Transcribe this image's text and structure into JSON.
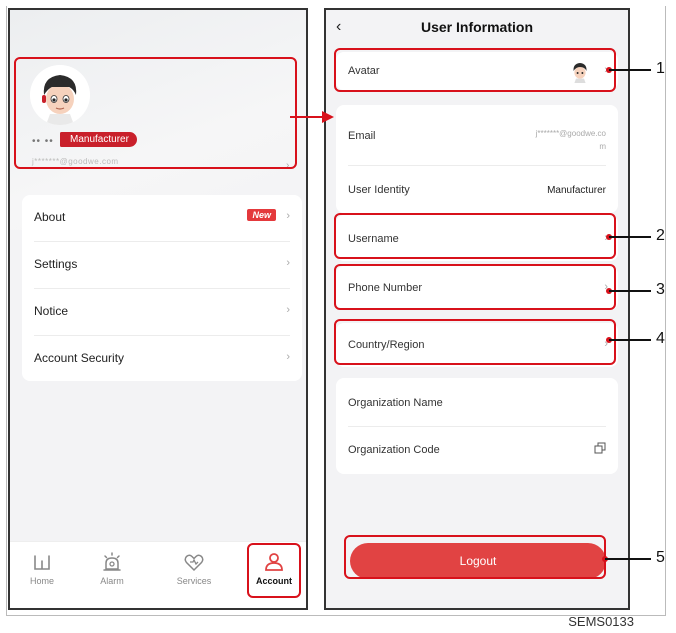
{
  "left": {
    "profile": {
      "name_masked": "•• ••",
      "role_badge": "Manufacturer",
      "email_masked": "j*******@goodwe.com",
      "chevron": "›"
    },
    "menu": [
      {
        "label": "About",
        "badge": "New",
        "chevron": "›"
      },
      {
        "label": "Settings",
        "chevron": "›"
      },
      {
        "label": "Notice",
        "chevron": "›"
      },
      {
        "label": "Account Security",
        "chevron": "›"
      }
    ],
    "tabs": [
      {
        "label": "Home",
        "icon": "home-icon",
        "active": false
      },
      {
        "label": "Alarm",
        "icon": "alarm-icon",
        "active": false
      },
      {
        "label": "Services",
        "icon": "services-icon",
        "active": false
      },
      {
        "label": "Account",
        "icon": "account-icon",
        "active": true
      }
    ]
  },
  "right": {
    "nav": {
      "back": "‹",
      "title": "User Information"
    },
    "avatar_row": {
      "label": "Avatar",
      "chevron": "›"
    },
    "email_row": {
      "label": "Email",
      "value_masked_1": "j*******@goodwe.co",
      "value_masked_2": "m"
    },
    "identity_row": {
      "label": "User Identity",
      "value": "Manufacturer"
    },
    "username_row": {
      "label": "Username",
      "chevron": "›"
    },
    "phone_row": {
      "label": "Phone Number",
      "chevron": "›"
    },
    "country_row": {
      "label": "Country/Region",
      "chevron": "›"
    },
    "org_name_row": {
      "label": "Organization Name"
    },
    "org_code_row": {
      "label": "Organization Code",
      "copy_icon": "copy-icon"
    },
    "logout": {
      "label": "Logout"
    }
  },
  "callouts": [
    "1",
    "2",
    "3",
    "4",
    "5"
  ],
  "caption": "SEMS0133",
  "colors": {
    "brand_red": "#e14343",
    "highlight_red": "#d8111b",
    "badge_red": "#c9202b"
  }
}
